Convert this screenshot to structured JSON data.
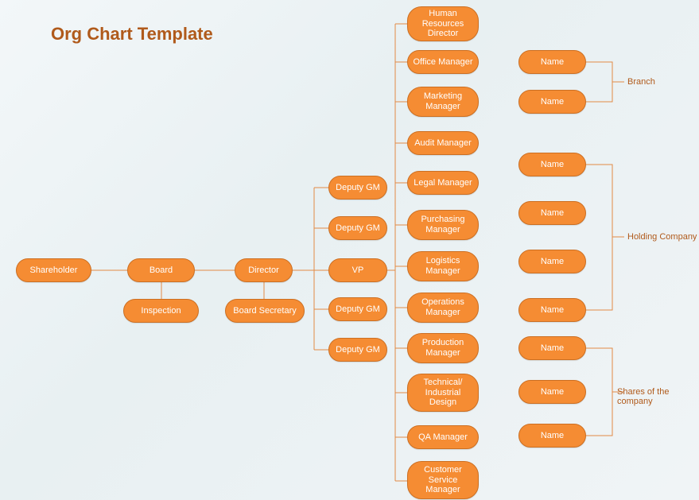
{
  "title": "Org Chart Template",
  "chart_data": {
    "type": "org-chart",
    "root": {
      "name": "Shareholder",
      "children": [
        {
          "name": "Board",
          "children": [
            {
              "name": "Inspection"
            },
            {
              "name": "Director",
              "children": [
                {
                  "name": "Board Secretary"
                },
                {
                  "name": "Deputy GM"
                },
                {
                  "name": "Deputy GM"
                },
                {
                  "name": "VP",
                  "children": [
                    {
                      "name": "Human Resources Director"
                    },
                    {
                      "name": "Office Manager"
                    },
                    {
                      "name": "Marketing Manager"
                    },
                    {
                      "name": "Audit Manager"
                    },
                    {
                      "name": "Legal Manager"
                    },
                    {
                      "name": "Purchasing Manager"
                    },
                    {
                      "name": "Logistics Manager"
                    },
                    {
                      "name": "Operations Manager"
                    },
                    {
                      "name": "Production Manager"
                    },
                    {
                      "name": "Technical/ Industrial Design"
                    },
                    {
                      "name": "QA Manager"
                    },
                    {
                      "name": "Customer Service Manager"
                    }
                  ]
                },
                {
                  "name": "Deputy GM"
                },
                {
                  "name": "Deputy GM"
                }
              ]
            }
          ]
        }
      ]
    },
    "groups": [
      {
        "label": "Branch",
        "items": [
          "Name",
          "Name"
        ]
      },
      {
        "label": "Holding Company",
        "items": [
          "Name",
          "Name",
          "Name",
          "Name"
        ]
      },
      {
        "label": "Shares of the company",
        "items": [
          "Name",
          "Name",
          "Name"
        ]
      }
    ]
  },
  "nodes": {
    "shareholder": "Shareholder",
    "board": "Board",
    "inspection": "Inspection",
    "director": "Director",
    "board_secretary": "Board Secretary",
    "deputy_gm_1": "Deputy GM",
    "deputy_gm_2": "Deputy GM",
    "vp": "VP",
    "deputy_gm_3": "Deputy GM",
    "deputy_gm_4": "Deputy GM",
    "hr_director": "Human Resources Director",
    "office_manager": "Office Manager",
    "marketing_manager": "Marketing Manager",
    "audit_manager": "Audit Manager",
    "legal_manager": "Legal Manager",
    "purchasing_manager": "Purchasing Manager",
    "logistics_manager": "Logistics Manager",
    "operations_manager": "Operations Manager",
    "production_manager": "Production Manager",
    "tech_design": "Technical/ Industrial Design",
    "qa_manager": "QA Manager",
    "cs_manager": "Customer Service Manager",
    "name_b1": "Name",
    "name_b2": "Name",
    "name_h1": "Name",
    "name_h2": "Name",
    "name_h3": "Name",
    "name_h4": "Name",
    "name_s1": "Name",
    "name_s2": "Name",
    "name_s3": "Name"
  },
  "labels": {
    "branch": "Branch",
    "holding": "Holding Company",
    "shares": "Shares of the company"
  }
}
